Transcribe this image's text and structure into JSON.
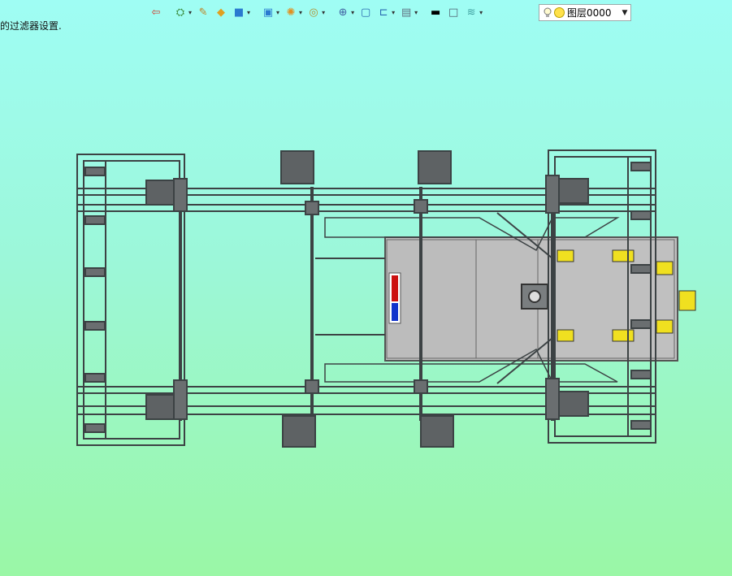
{
  "status_text": "的过滤器设置.",
  "toolbar": {
    "items": [
      {
        "name": "exit-icon",
        "glyph": "⇦",
        "has_menu": false,
        "color": "#d04030"
      },
      {
        "name": "filter-icon",
        "glyph": "⛭",
        "has_menu": true,
        "color": "#3a8a3a"
      },
      {
        "name": "pencil-icon",
        "glyph": "✎",
        "has_menu": false,
        "color": "#c08020"
      },
      {
        "name": "solid-box-icon",
        "glyph": "◆",
        "has_menu": false,
        "color": "#e0a020"
      },
      {
        "name": "shaded-cube-icon",
        "glyph": "■",
        "has_menu": true,
        "color": "#2a7ad0"
      },
      {
        "name": "view-cube-icon",
        "glyph": "▣",
        "has_menu": true,
        "color": "#2a7ad0"
      },
      {
        "name": "gear-sphere-icon",
        "glyph": "✺",
        "has_menu": true,
        "color": "#e09020"
      },
      {
        "name": "render-mode-icon",
        "glyph": "◎",
        "has_menu": true,
        "color": "#b09030"
      },
      {
        "name": "snap-target-icon",
        "glyph": "⊕",
        "has_menu": true,
        "color": "#4060a0"
      },
      {
        "name": "window-icon",
        "glyph": "▢",
        "has_menu": false,
        "color": "#2a6ab0"
      },
      {
        "name": "dimension-icon",
        "glyph": "⊏",
        "has_menu": true,
        "color": "#2a6ab0"
      },
      {
        "name": "background-icon",
        "glyph": "▤",
        "has_menu": true,
        "color": "#607080"
      },
      {
        "name": "line-color-icon",
        "glyph": "▬",
        "has_menu": false,
        "color": "#000000"
      },
      {
        "name": "fill-color-icon",
        "glyph": "□",
        "has_menu": false,
        "color": "#506070"
      },
      {
        "name": "layer-stack-icon",
        "glyph": "≋",
        "has_menu": true,
        "color": "#40a0a0"
      }
    ]
  },
  "layer": {
    "value": "图层0000",
    "dropdown_glyph": "▼"
  },
  "colors": {
    "bg_top": "#9ffdf4",
    "bg_bottom": "#9af7a6",
    "frame": "#4a4e50",
    "panel": "#c0c0c0",
    "accent_yellow": "#f0e020",
    "indicator_red": "#cc1111",
    "indicator_blue": "#1133cc"
  }
}
